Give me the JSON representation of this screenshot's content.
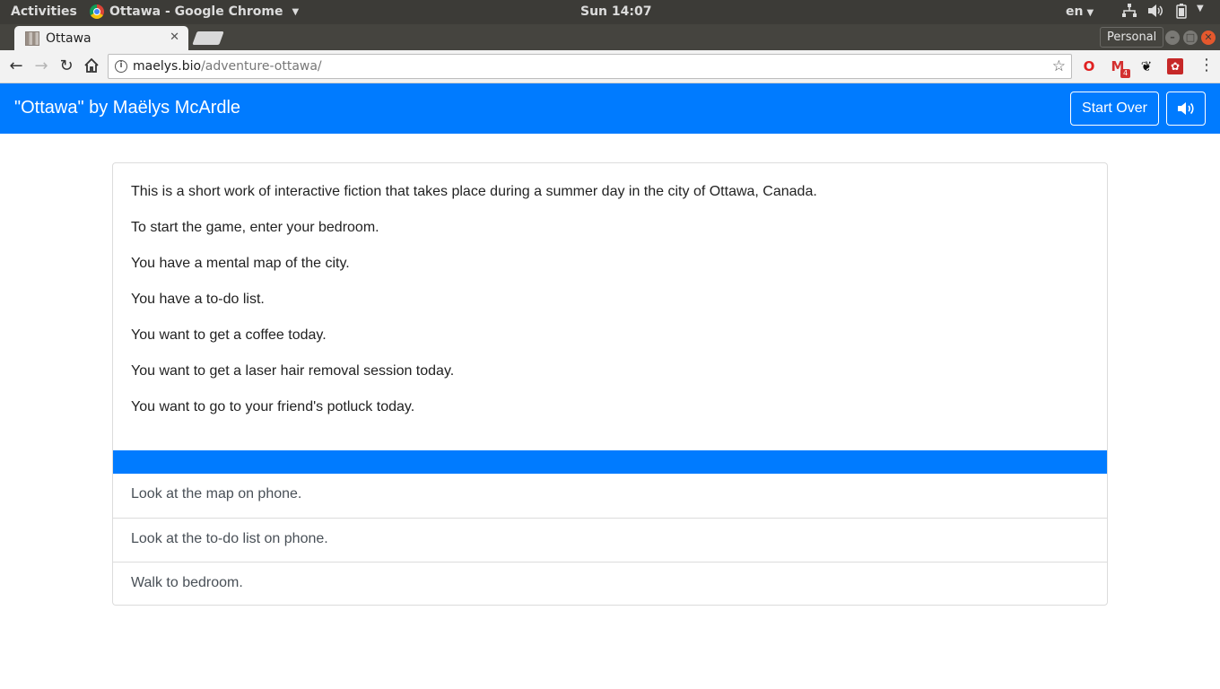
{
  "os_bar": {
    "activities": "Activities",
    "app_menu": "Ottawa - Google Chrome",
    "clock": "Sun 14:07",
    "language": "en"
  },
  "browser": {
    "tab_title": "Ottawa",
    "profile": "Personal",
    "url_host": "maelys.bio",
    "url_path": "/adventure-ottawa/",
    "ext_badge": "4"
  },
  "app": {
    "title": "\"Ottawa\" by Maëlys McArdle",
    "start_over": "Start Over",
    "accent": "#007bff"
  },
  "story": {
    "paragraphs": [
      "This is a short work of interactive fiction that takes place during a summer day in the city of Ottawa, Canada.",
      "To start the game, enter your bedroom.",
      "You have a mental map of the city.",
      "You have a to-do list.",
      "You want to get a coffee today.",
      "You want to get a laser hair removal session today.",
      "You want to go to your friend's potluck today."
    ],
    "choices": [
      "Look at the map on phone.",
      "Look at the to-do list on phone.",
      "Walk to bedroom."
    ]
  }
}
